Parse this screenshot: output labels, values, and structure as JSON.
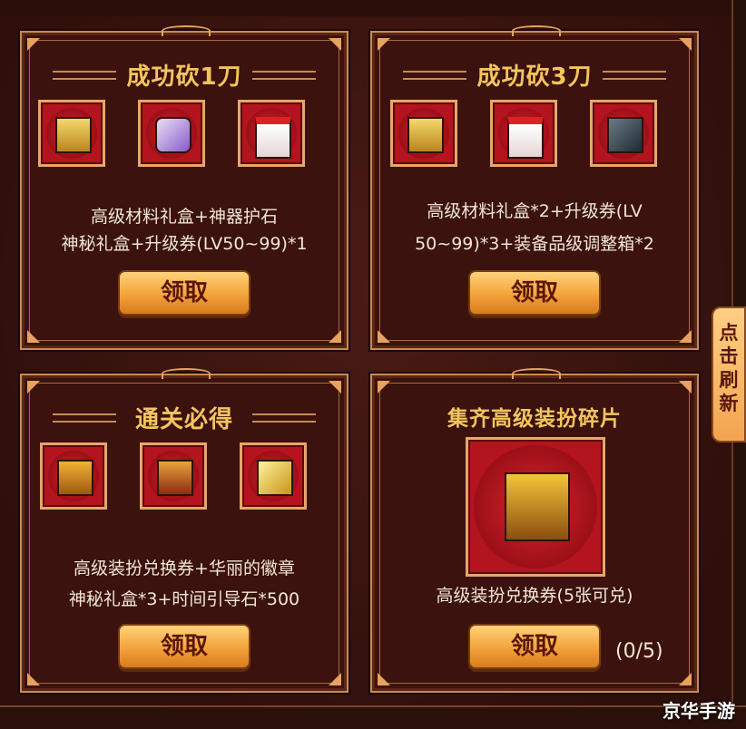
{
  "panels": [
    {
      "title": "成功砍1刀",
      "items": [
        "gold-chest-icon",
        "purple-stone-icon",
        "lv-ticket-icon"
      ],
      "desc_line1": "高级材料礼盒+神器护石",
      "desc_line2": "神秘礼盒+升级券(LV50~99)*1",
      "button_label": "领取"
    },
    {
      "title": "成功砍3刀",
      "items": [
        "gold-chest-icon",
        "lv-ticket-icon",
        "equipment-box-icon"
      ],
      "desc_line1": "高级材料礼盒*2+升级券(LV",
      "desc_line2": "50~99)*3+装备品级调整箱*2",
      "button_label": "领取"
    },
    {
      "title": "通关必得",
      "items": [
        "treasure-chest-icon",
        "ornate-chest-icon",
        "gold-cube-icon"
      ],
      "desc_line1": "高级装扮兑换券+华丽的徽章",
      "desc_line2": "神秘礼盒*3+时间引导石*500",
      "button_label": "领取"
    },
    {
      "title": "集齐高级装扮碎片",
      "items": [
        "big-treasure-chest-icon"
      ],
      "desc_line1": "高级装扮兑换券(5张可兑)",
      "button_label": "领取",
      "progress_text": "(0/5)"
    }
  ],
  "refresh_tab": {
    "chars": [
      "点",
      "击",
      "刷",
      "新"
    ]
  },
  "watermark": "京华手游",
  "colors": {
    "title": "#f3c460",
    "button": "#f3a23a",
    "slot": "#b3141e"
  }
}
